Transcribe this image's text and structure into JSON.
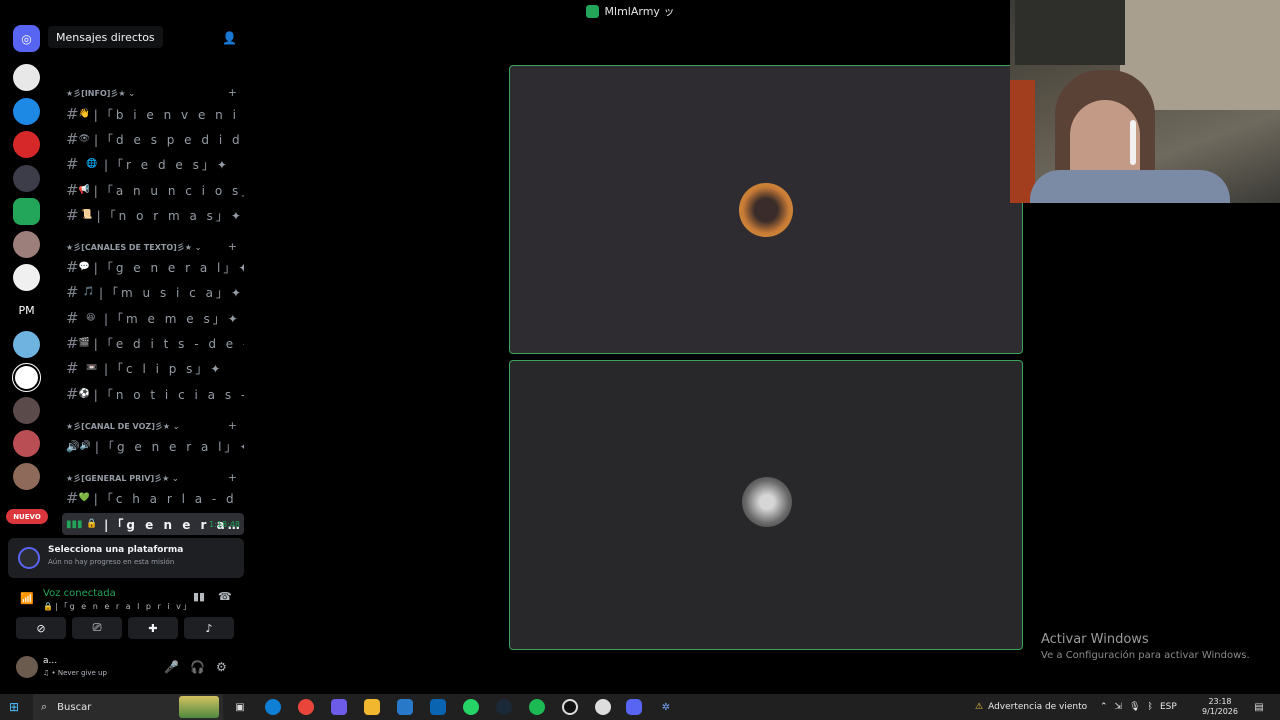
{
  "window_title": "MlmlArmy ッ",
  "tooltip": "Mensajes directos",
  "nuevo_badge": "NUEVO",
  "servers": [
    {
      "label": "",
      "color": "#5865f2"
    },
    {
      "label": "",
      "color": "#e8e8e8"
    },
    {
      "label": "",
      "color": "#1e88e5"
    },
    {
      "label": "",
      "color": "#d62828"
    },
    {
      "label": "",
      "color": "#3d3d4a"
    },
    {
      "label": "",
      "color": "#23a55a"
    },
    {
      "label": "",
      "color": "#9c7e7a"
    },
    {
      "label": "",
      "color": "#f0f0f0"
    },
    {
      "label": "PM",
      "color": "#000000"
    },
    {
      "label": "",
      "color": "#6fb3e0"
    },
    {
      "label": "",
      "color": "#ffffff"
    },
    {
      "label": "",
      "color": "#5a4a4a"
    },
    {
      "label": "",
      "color": "#b94f55"
    },
    {
      "label": "",
      "color": "#8d6a5a"
    }
  ],
  "categories": [
    {
      "name": "★彡[INFO]彡★ ⌄"
    },
    {
      "name": "★彡[CANALES DE TEXTO]彡★ ⌄"
    },
    {
      "name": "★彡[CANAL DE VOZ]彡★ ⌄"
    },
    {
      "name": "★彡[GENERAL PRIV]彡★ ⌄"
    }
  ],
  "channels": {
    "info": [
      {
        "emoji": "👋",
        "label": "|「b i e n v e n i d…"
      },
      {
        "emoji": "👁",
        "label": "|「d e s p e d i d a…"
      },
      {
        "emoji": "🌐",
        "label": "|「r e d e s」✦"
      },
      {
        "emoji": "📢",
        "label": "|「a n u n c i o s」✦"
      },
      {
        "emoji": "📜",
        "label": "|「n o r m a s」✦"
      }
    ],
    "texto": [
      {
        "emoji": "💬",
        "label": "|「g e n e r a l」✦"
      },
      {
        "emoji": "🎵",
        "label": "|「m u s i c a」✦"
      },
      {
        "emoji": "😆",
        "label": "|「m e m e s」✦"
      },
      {
        "emoji": "🎬",
        "label": "|「e d i t s - d e - m i…"
      },
      {
        "emoji": "📼",
        "label": "|「c l i p s」✦"
      },
      {
        "emoji": "⚽",
        "label": "|「n o t i c i a s - d…"
      }
    ],
    "voz": [
      {
        "emoji": "🔊",
        "label": "|「g e n e r a l」✦"
      }
    ],
    "priv": [
      {
        "emoji": "💚",
        "label": "|「c h a r l a - d e - s…"
      },
      {
        "emoji": "🔒",
        "label": "|「g e n e r a…",
        "time": "1:18:48"
      }
    ]
  },
  "activity_panel": {
    "title": "Selecciona una plataforma",
    "subtitle": "Aún no hay progreso en esta misión"
  },
  "voice": {
    "status": "Voz conectada",
    "channel": "🔒|「g e n e r a l p r i v」✦/…"
  },
  "user": {
    "name": "a...",
    "status": "♫ • Never give up"
  },
  "activate_windows": {
    "title": "Activar Windows",
    "subtitle": "Ve a Configuración para activar Windows."
  },
  "taskbar": {
    "search_label": "Buscar",
    "weather": "Advertencia de viento",
    "lang": "ESP",
    "time": "23:18",
    "date": "9/1/2026"
  }
}
